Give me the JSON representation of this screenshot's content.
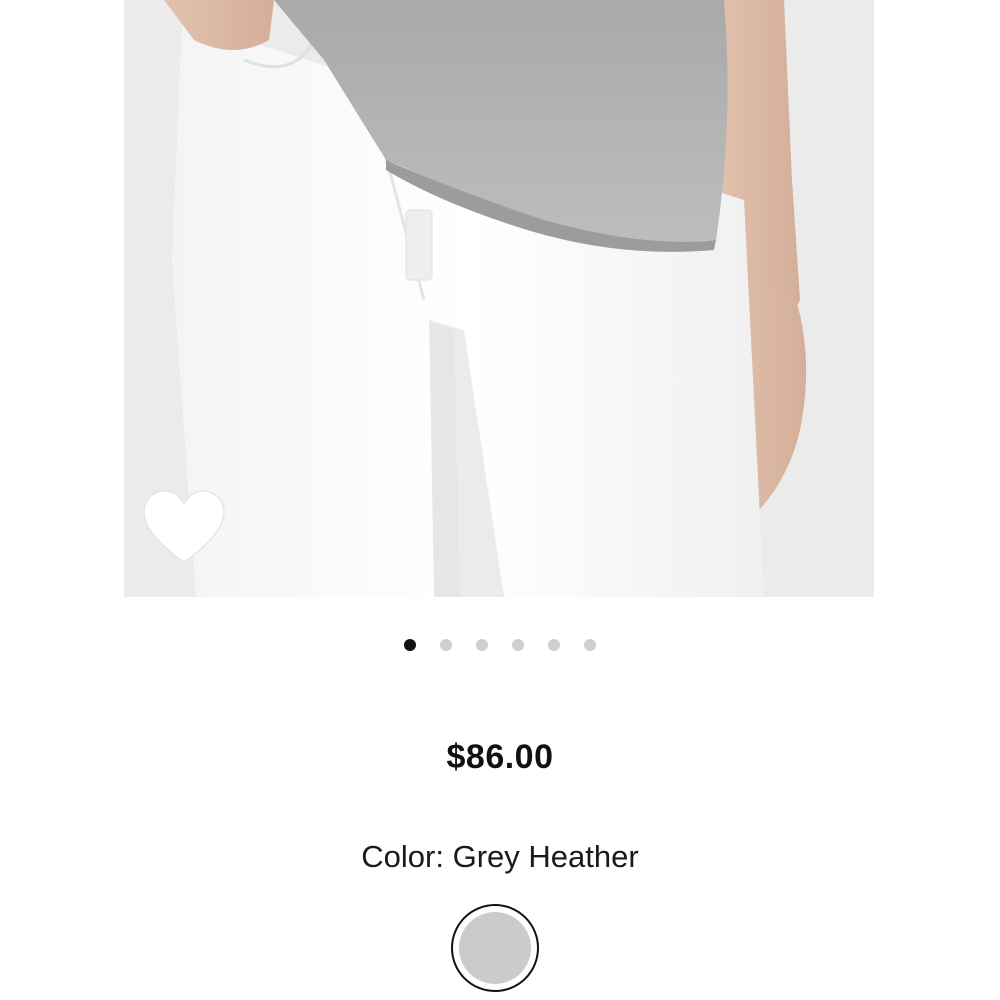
{
  "product": {
    "price": "$86.00",
    "color_label": "Color:",
    "color_value": "Grey Heather",
    "swatch_color": "#cbcbc9"
  },
  "gallery": {
    "image_count": 6,
    "active_index": 0,
    "background_color": "#ebebeb"
  },
  "icons": {
    "wishlist": "heart-icon"
  }
}
